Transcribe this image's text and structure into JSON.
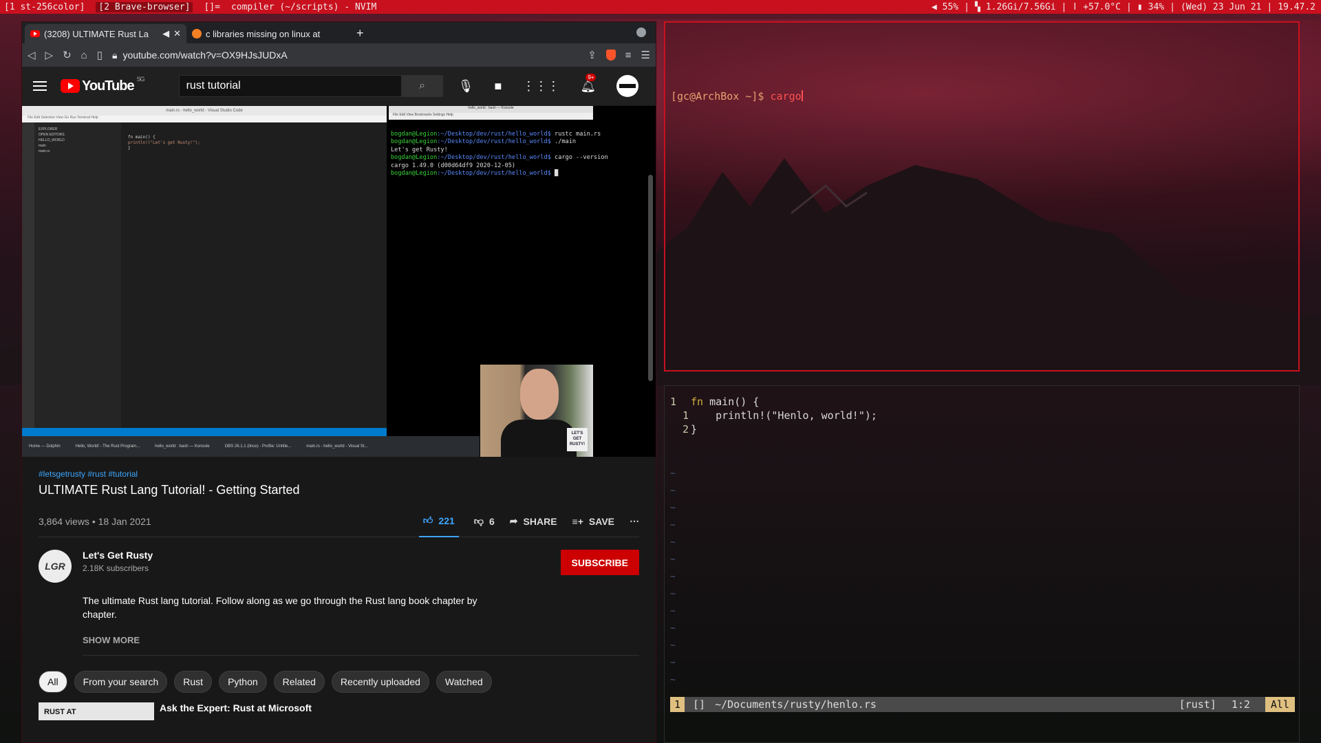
{
  "topbar": {
    "ws1": "[1 st-256color]",
    "ws2": "[2 Brave-browser]",
    "layout": "[]=",
    "window_title": "compiler (~/scripts) - NVIM",
    "volume": "55%",
    "memory": "1.26Gi/7.56Gi",
    "temp": "+57.0°C",
    "battery": "34%",
    "date": "(Wed) 23 Jun 21",
    "time": "19.47.2"
  },
  "browser": {
    "tab1": "(3208) ULTIMATE Rust La",
    "tab2": "c libraries missing on linux at",
    "url": "youtube.com/watch?v=OX9HJsJUDxA"
  },
  "youtube": {
    "region": "SG",
    "search_value": "rust tutorial",
    "notification_count": "9+",
    "video": {
      "vscode_title": "main.rs - hello_world - Visual Studio Code",
      "vscode_sidebar": [
        "EXPLORER",
        "OPEN EDITORS",
        "HELLO_WORLD",
        "main",
        "main.rs"
      ],
      "vscode_code": [
        "fn main() {",
        "    println!(\"Let's get Rusty!\");",
        "}"
      ],
      "konsole_title": "hello_world : bash — Konsole",
      "konsole_menu": "File  Edit  View  Bookmarks  Settings  Help",
      "konsole_lines": [
        {
          "prompt": "bogdan@Legion",
          "path": ":~/Desktop/dev/rust/hello_world$",
          "cmd": " rustc main.rs"
        },
        {
          "prompt": "bogdan@Legion",
          "path": ":~/Desktop/dev/rust/hello_world$",
          "cmd": " ./main"
        },
        {
          "prompt": "",
          "path": "",
          "cmd": "Let's get Rusty!"
        },
        {
          "prompt": "bogdan@Legion",
          "path": ":~/Desktop/dev/rust/hello_world$",
          "cmd": " cargo --version"
        },
        {
          "prompt": "",
          "path": "",
          "cmd": "cargo 1.49.0 (d00d64df9 2020-12-05)"
        },
        {
          "prompt": "bogdan@Legion",
          "path": ":~/Desktop/dev/rust/hello_world$",
          "cmd": " █"
        }
      ],
      "taskbar": [
        "Home — Dolphin",
        "Hello, World! - The Rust Program...",
        "hello_world : bash — Konsole",
        "OBS 26.1.1 (linux) - Profile: Untitle...",
        "main.rs - hello_world - Visual St..."
      ],
      "webcam_sign": "LET'S GET RUSTY!"
    },
    "hashtags": "#letsgetrusty #rust #tutorial",
    "title": "ULTIMATE Rust Lang Tutorial! - Getting Started",
    "views": "3,864 views • 18 Jan 2021",
    "likes": "221",
    "dislikes": "6",
    "share": "SHARE",
    "save": "SAVE",
    "channel_name": "Let's Get Rusty",
    "channel_avatar": "LGR",
    "subscribers": "2.18K subscribers",
    "subscribe": "SUBSCRIBE",
    "description": "The ultimate Rust lang tutorial. Follow along as we go through the Rust lang book chapter by chapter.",
    "show_more": "SHOW MORE",
    "chips": [
      "All",
      "From your search",
      "Rust",
      "Python",
      "Related",
      "Recently uploaded",
      "Watched"
    ],
    "next_thumb": "RUST AT",
    "next_title": "Ask the Expert: Rust at Microsoft"
  },
  "terminal": {
    "prompt_open": "[",
    "user_host": "gc@ArchBox",
    "cwd": " ~",
    "prompt_close": "]$ ",
    "command": "cargo"
  },
  "nvim": {
    "lines": [
      {
        "num": "1",
        "pre": "",
        "kw": "fn",
        "rest": " main() {"
      },
      {
        "num": "  1",
        "pre": "    ",
        "kw": "",
        "rest": "println!(\"Henlo, world!\");"
      },
      {
        "num": "  2",
        "pre": "",
        "kw": "",
        "rest": "}"
      }
    ],
    "status_mode": "1",
    "status_flags": "[]",
    "status_path": "~/Documents/rusty/henlo.rs",
    "status_ft": "[rust]",
    "status_pos": "1:2",
    "status_all": "All"
  }
}
